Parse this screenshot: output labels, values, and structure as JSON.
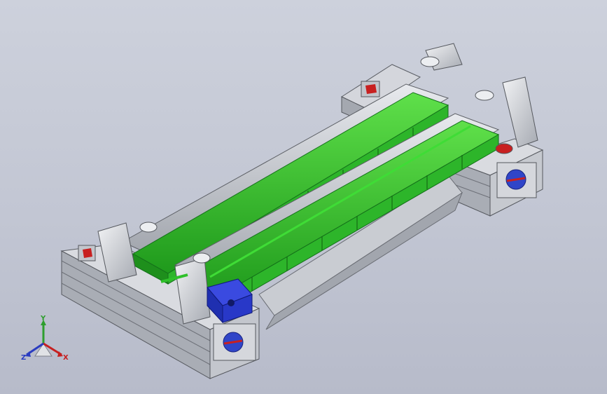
{
  "viewport": {
    "background_top": "#cdd1dc",
    "background_bottom": "#b7bbca"
  },
  "model": {
    "frame_color": "#b4b8bf",
    "frame_dark": "#8d9098",
    "conveyor_belt_color": "#2fc02a",
    "belt_dark": "#1e8f1c",
    "motor_color": "#1f2fd0",
    "accent_red": "#c82020"
  },
  "triad": {
    "x_label": "X",
    "y_label": "Y",
    "z_label": "Z",
    "x_color": "#c62020",
    "y_color": "#2e9e2e",
    "z_color": "#2a3cc0"
  }
}
